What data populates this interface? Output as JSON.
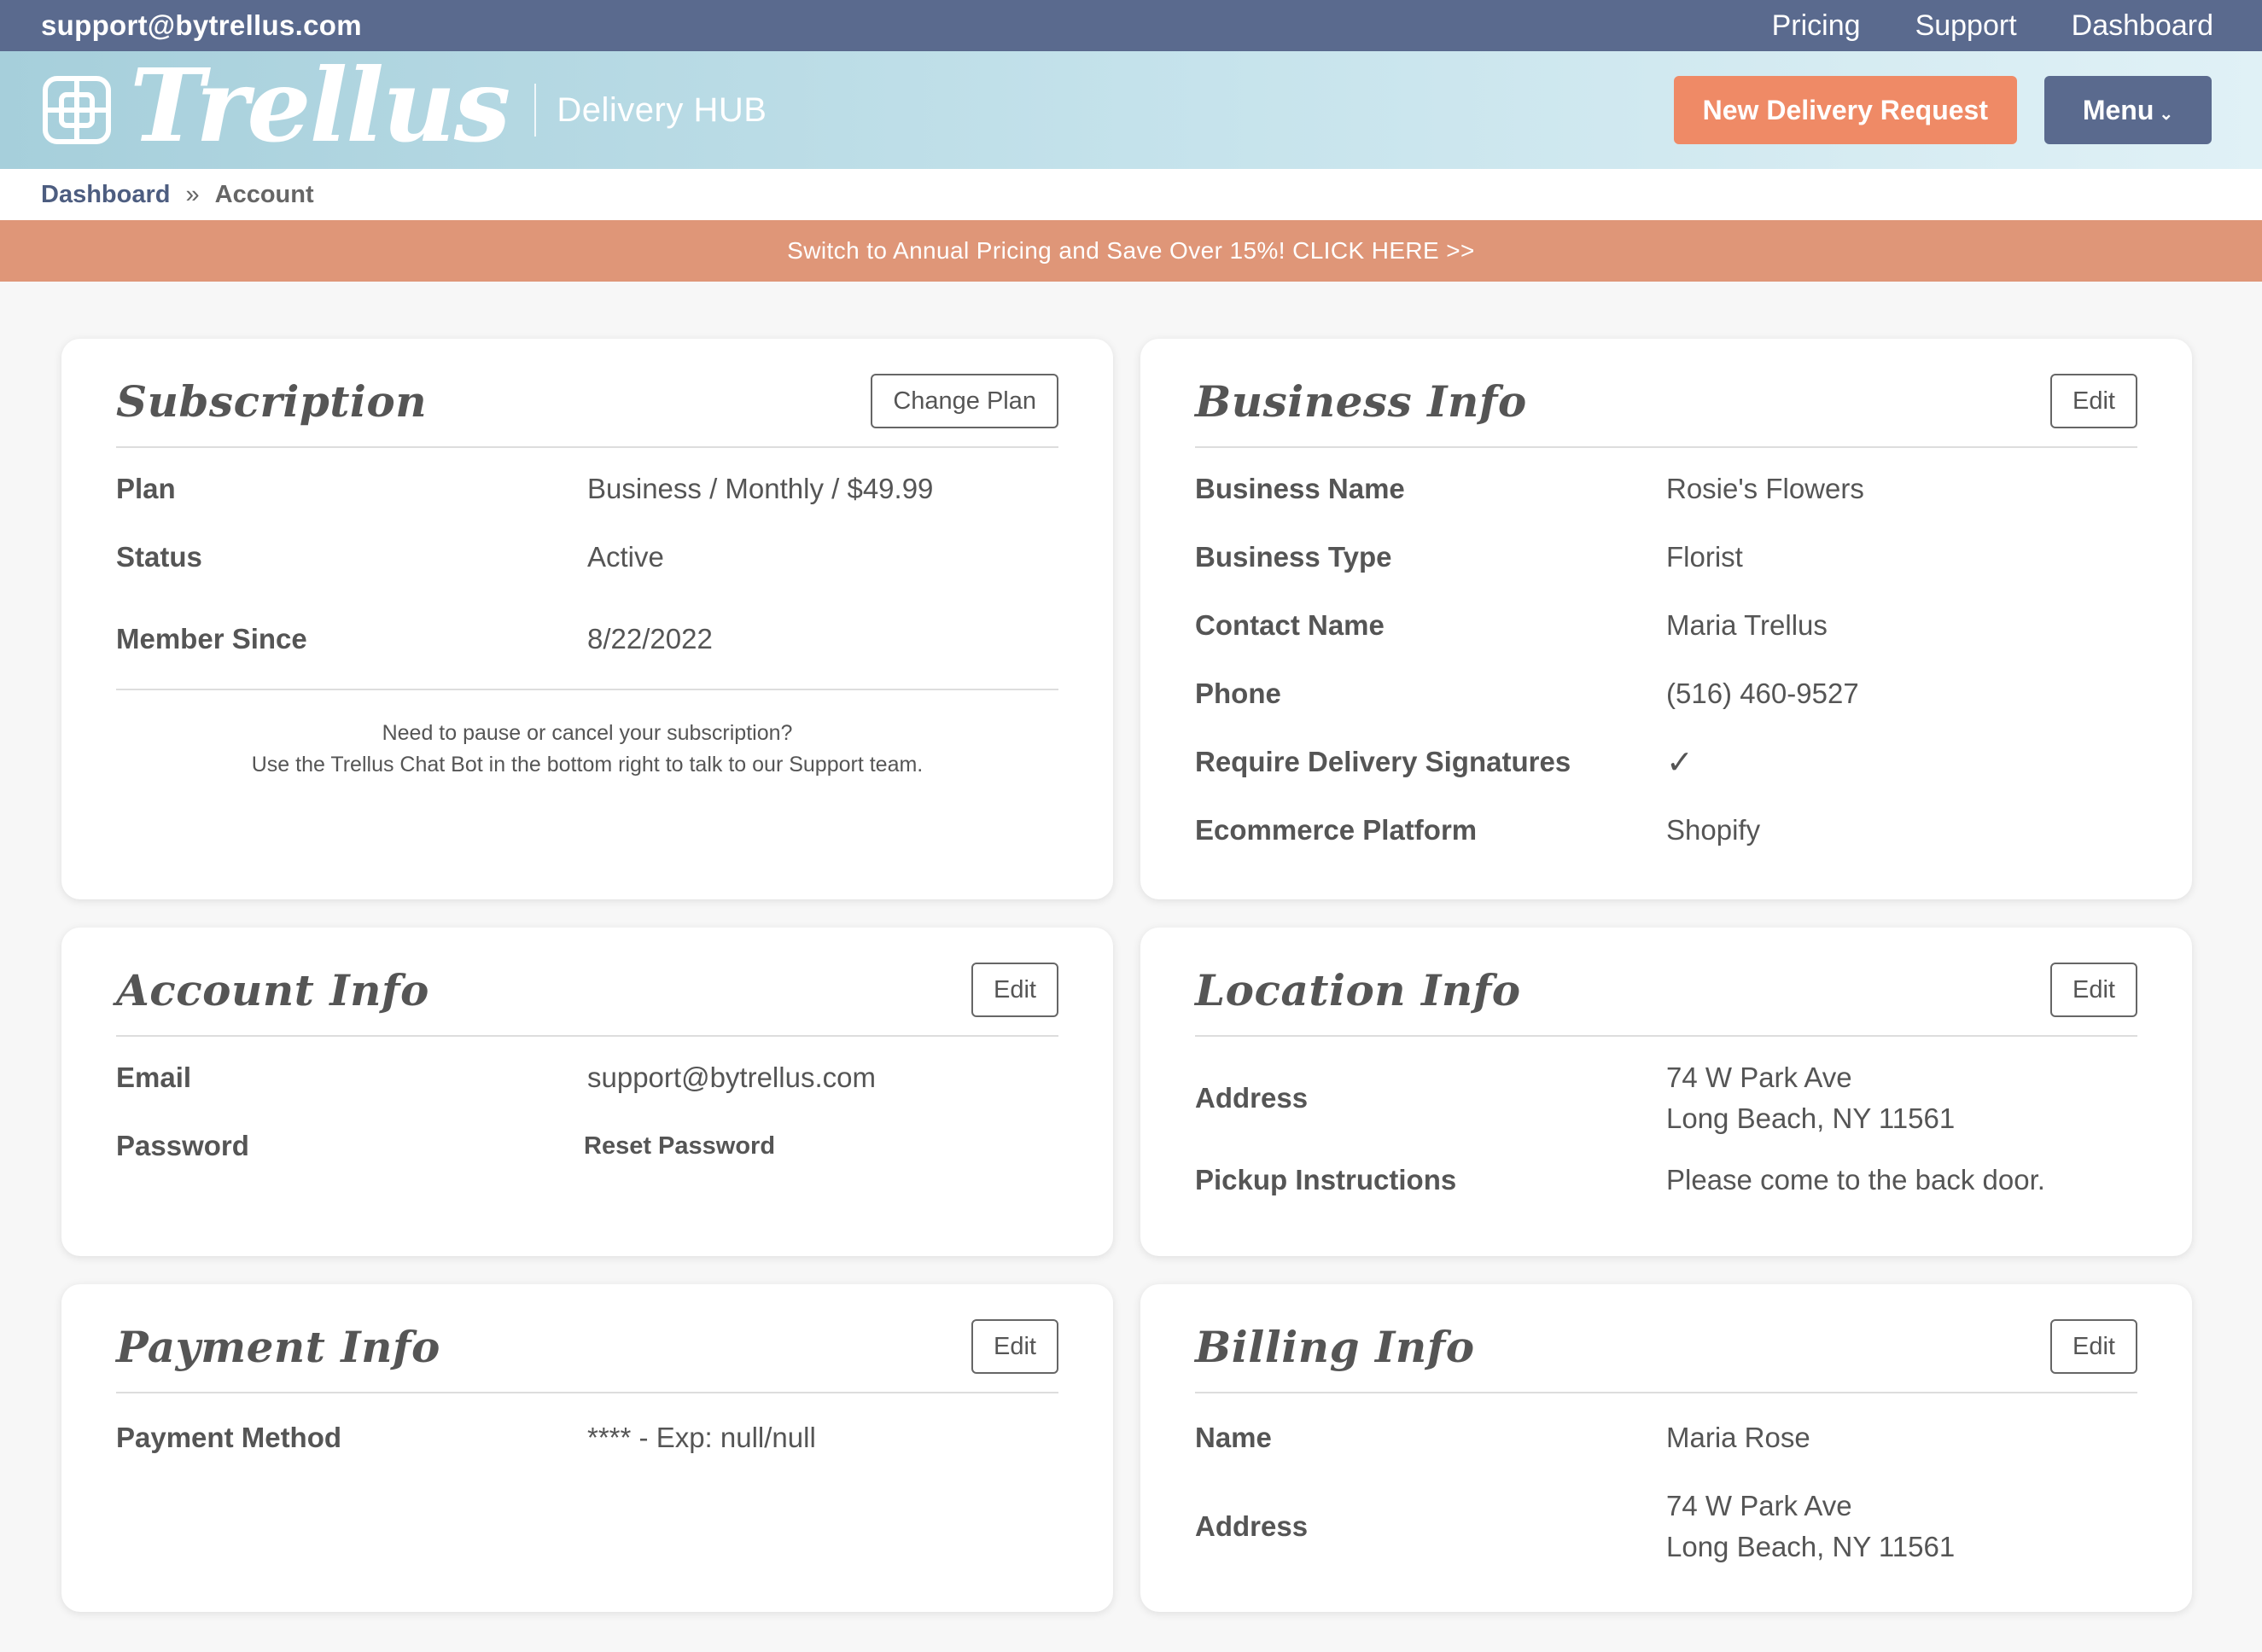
{
  "topbar": {
    "email": "support@bytrellus.com",
    "nav": [
      "Pricing",
      "Support",
      "Dashboard"
    ]
  },
  "brand": {
    "name": "Trellus",
    "subtitle": "Delivery HUB",
    "icon": "lattice-logo-icon"
  },
  "header": {
    "new_delivery_label": "New Delivery Request",
    "menu_label": "Menu"
  },
  "breadcrumb": {
    "root": "Dashboard",
    "separator": "»",
    "current": "Account"
  },
  "promo": {
    "text": "Switch to Annual Pricing and Save Over 15%! CLICK HERE >>"
  },
  "subscription": {
    "title": "Subscription",
    "button": "Change Plan",
    "rows": [
      {
        "label": "Plan",
        "value": "Business / Monthly / $49.99"
      },
      {
        "label": "Status",
        "value": "Active"
      },
      {
        "label": "Member Since",
        "value": "8/22/2022"
      }
    ],
    "note_line1": "Need to pause or cancel your subscription?",
    "note_line2": "Use the Trellus Chat Bot in the bottom right to talk to our Support team."
  },
  "business": {
    "title": "Business Info",
    "button": "Edit",
    "rows": [
      {
        "label": "Business Name",
        "value": "Rosie's Flowers"
      },
      {
        "label": "Business Type",
        "value": "Florist"
      },
      {
        "label": "Contact Name",
        "value": "Maria Trellus"
      },
      {
        "label": "Phone",
        "value": "(516) 460-9527"
      },
      {
        "label": "Require Delivery Signatures",
        "value": "✓"
      },
      {
        "label": "Ecommerce Platform",
        "value": "Shopify"
      }
    ]
  },
  "account": {
    "title": "Account Info",
    "button": "Edit",
    "rows": [
      {
        "label": "Email",
        "value": "support@bytrellus.com"
      },
      {
        "label": "Password",
        "value": "Reset Password"
      }
    ]
  },
  "location": {
    "title": "Location Info",
    "button": "Edit",
    "address_label": "Address",
    "address_line1": "74 W Park Ave",
    "address_line2": "Long Beach, NY 11561",
    "pickup_label": "Pickup Instructions",
    "pickup_value": "Please come to the back door."
  },
  "payment": {
    "title": "Payment Info",
    "button": "Edit",
    "rows": [
      {
        "label": "Payment Method",
        "value": "**** - Exp: null/null"
      }
    ]
  },
  "billing": {
    "title": "Billing Info",
    "button": "Edit",
    "name_label": "Name",
    "name_value": "Maria Rose",
    "address_label": "Address",
    "address_line1": "74 W Park Ave",
    "address_line2": "Long Beach, NY 11561"
  },
  "colors": {
    "navy": "#5a6a8e",
    "accent_orange": "#ef8a66",
    "promo_bg": "#df9678",
    "header_gradient_start": "#a6cfdb",
    "header_gradient_end": "#e0f1f6",
    "page_bg": "#f7f7f7"
  }
}
